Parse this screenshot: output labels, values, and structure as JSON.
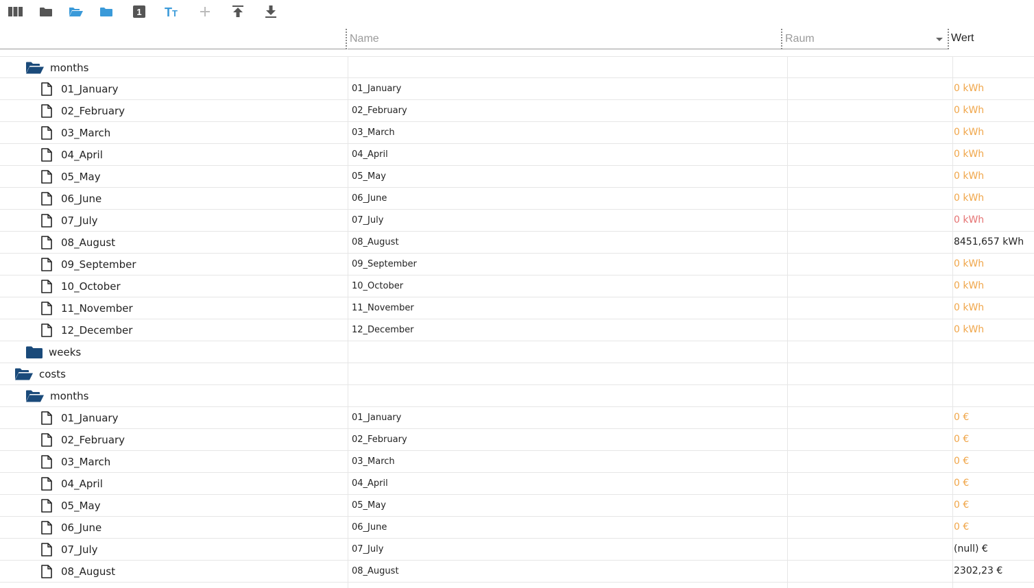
{
  "toolbar": {
    "buttons": [
      {
        "name": "columns-icon",
        "color": "#555555"
      },
      {
        "name": "folder-icon",
        "color": "#555555"
      },
      {
        "name": "folder-open-icon",
        "color": "#3a9ad9"
      },
      {
        "name": "folder-icon",
        "color": "#3a9ad9"
      },
      {
        "name": "number-one-icon",
        "color": "#555555"
      },
      {
        "name": "text-size-icon",
        "color": "#3a9ad9"
      },
      {
        "name": "plus-icon",
        "color": "#bbbbbb"
      },
      {
        "name": "upload-icon",
        "color": "#555555"
      },
      {
        "name": "download-icon",
        "color": "#555555"
      }
    ]
  },
  "header": {
    "name_placeholder": "Name",
    "room_placeholder": "Raum",
    "value_label": "Wert"
  },
  "colors": {
    "folder": "#1a4a7a",
    "value_orange": "#f0a64a",
    "value_red": "#e57373",
    "value_normal": "#222222"
  },
  "rows": [
    {
      "type": "folder",
      "open": true,
      "level": 1,
      "label": "months",
      "name": "",
      "value": "",
      "value_color": ""
    },
    {
      "type": "file",
      "level": 2,
      "label": "01_January",
      "name": "01_January",
      "value": "0 kWh",
      "value_color": "orange"
    },
    {
      "type": "file",
      "level": 2,
      "label": "02_February",
      "name": "02_February",
      "value": "0 kWh",
      "value_color": "orange"
    },
    {
      "type": "file",
      "level": 2,
      "label": "03_March",
      "name": "03_March",
      "value": "0 kWh",
      "value_color": "orange"
    },
    {
      "type": "file",
      "level": 2,
      "label": "04_April",
      "name": "04_April",
      "value": "0 kWh",
      "value_color": "orange"
    },
    {
      "type": "file",
      "level": 2,
      "label": "05_May",
      "name": "05_May",
      "value": "0 kWh",
      "value_color": "orange"
    },
    {
      "type": "file",
      "level": 2,
      "label": "06_June",
      "name": "06_June",
      "value": "0 kWh",
      "value_color": "orange"
    },
    {
      "type": "file",
      "level": 2,
      "label": "07_July",
      "name": "07_July",
      "value": "0 kWh",
      "value_color": "red"
    },
    {
      "type": "file",
      "level": 2,
      "label": "08_August",
      "name": "08_August",
      "value": "8451,657 kWh",
      "value_color": "normal"
    },
    {
      "type": "file",
      "level": 2,
      "label": "09_September",
      "name": "09_September",
      "value": "0 kWh",
      "value_color": "orange"
    },
    {
      "type": "file",
      "level": 2,
      "label": "10_October",
      "name": "10_October",
      "value": "0 kWh",
      "value_color": "orange"
    },
    {
      "type": "file",
      "level": 2,
      "label": "11_November",
      "name": "11_November",
      "value": "0 kWh",
      "value_color": "orange"
    },
    {
      "type": "file",
      "level": 2,
      "label": "12_December",
      "name": "12_December",
      "value": "0 kWh",
      "value_color": "orange"
    },
    {
      "type": "folder",
      "open": false,
      "level": 1,
      "label": "weeks",
      "name": "",
      "value": "",
      "value_color": ""
    },
    {
      "type": "folder",
      "open": true,
      "level": 0,
      "label": "costs",
      "name": "",
      "value": "",
      "value_color": ""
    },
    {
      "type": "folder",
      "open": true,
      "level": 1,
      "label": "months",
      "name": "",
      "value": "",
      "value_color": ""
    },
    {
      "type": "file",
      "level": 2,
      "label": "01_January",
      "name": "01_January",
      "value": "0 €",
      "value_color": "orange"
    },
    {
      "type": "file",
      "level": 2,
      "label": "02_February",
      "name": "02_February",
      "value": "0 €",
      "value_color": "orange"
    },
    {
      "type": "file",
      "level": 2,
      "label": "03_March",
      "name": "03_March",
      "value": "0 €",
      "value_color": "orange"
    },
    {
      "type": "file",
      "level": 2,
      "label": "04_April",
      "name": "04_April",
      "value": "0 €",
      "value_color": "orange"
    },
    {
      "type": "file",
      "level": 2,
      "label": "05_May",
      "name": "05_May",
      "value": "0 €",
      "value_color": "orange"
    },
    {
      "type": "file",
      "level": 2,
      "label": "06_June",
      "name": "06_June",
      "value": "0 €",
      "value_color": "orange"
    },
    {
      "type": "file",
      "level": 2,
      "label": "07_July",
      "name": "07_July",
      "value": "(null) €",
      "value_color": "normal"
    },
    {
      "type": "file",
      "level": 2,
      "label": "08_August",
      "name": "08_August",
      "value": "2302,23 €",
      "value_color": "normal"
    }
  ]
}
